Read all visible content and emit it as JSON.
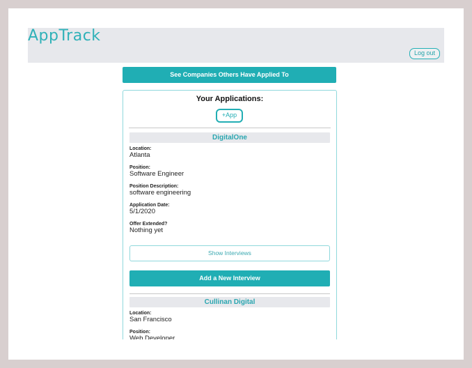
{
  "navbar": {
    "brand": "AppTrack",
    "logout_label": "Log out"
  },
  "others_button_label": "See Companies Others Have Applied To",
  "applications_panel": {
    "title": "Your Applications:",
    "add_app_label": "+App"
  },
  "field_labels": {
    "location": "Location:",
    "position": "Position:",
    "description": "Position Description:",
    "date": "Application Date:",
    "offer": "Offer Extended?"
  },
  "applications": [
    {
      "company": "DigitalOne",
      "location": "Atlanta",
      "position": "Software Engineer",
      "description": "software engineering",
      "date": "5/1/2020",
      "offer": "Nothing yet",
      "show_interviews_label": "Show Interviews",
      "add_interview_label": "Add a New Interview"
    },
    {
      "company": "Cullinan Digital",
      "location": "San Francisco",
      "position": "Web Developer"
    }
  ],
  "colors": {
    "accent": "#20aeb4",
    "navbar_bg": "#e7e8ec",
    "page_bg": "#d8cfcf"
  }
}
